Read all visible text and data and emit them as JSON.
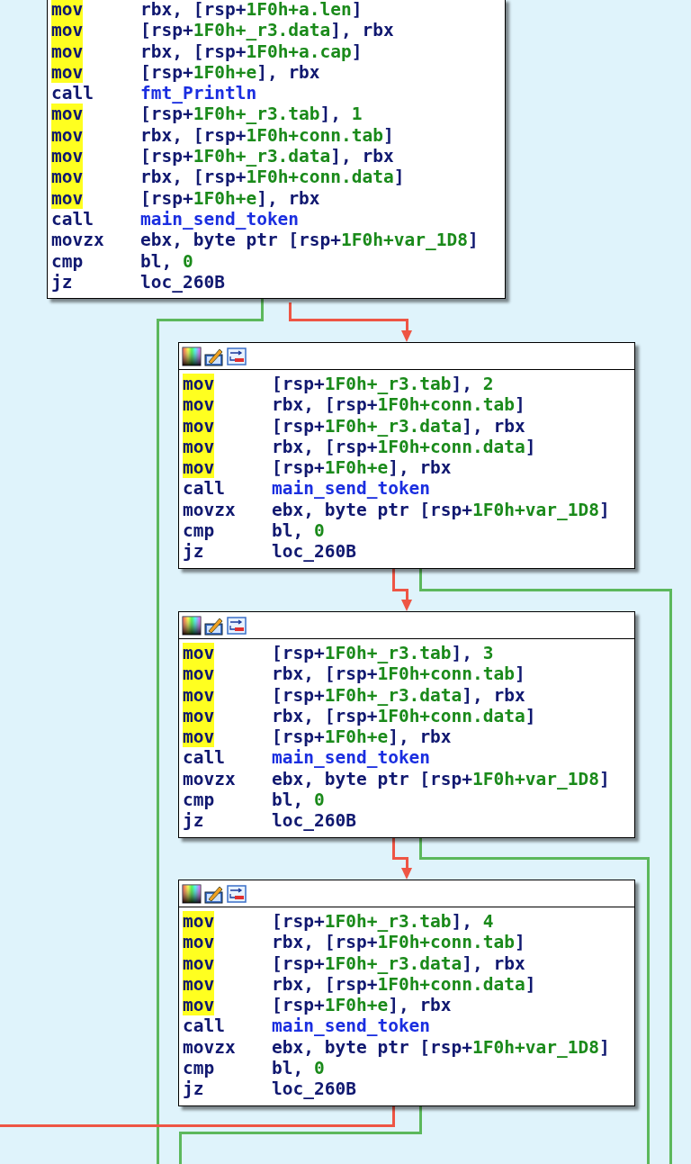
{
  "blocks": [
    {
      "toolbar": false,
      "lines": [
        {
          "mnemonic": "mov",
          "highlighted": true,
          "operand": [
            {
              "text": "rbx, [rsp+",
              "kind": "reg"
            },
            {
              "text": "1F0h+a.len",
              "kind": "num"
            },
            {
              "text": "]",
              "kind": "reg"
            }
          ]
        },
        {
          "mnemonic": "mov",
          "highlighted": true,
          "operand": [
            {
              "text": "[rsp+",
              "kind": "reg"
            },
            {
              "text": "1F0h+_r3.data",
              "kind": "num"
            },
            {
              "text": "], rbx",
              "kind": "reg"
            }
          ]
        },
        {
          "mnemonic": "mov",
          "highlighted": true,
          "operand": [
            {
              "text": "rbx, [rsp+",
              "kind": "reg"
            },
            {
              "text": "1F0h+a.cap",
              "kind": "num"
            },
            {
              "text": "]",
              "kind": "reg"
            }
          ]
        },
        {
          "mnemonic": "mov",
          "highlighted": true,
          "operand": [
            {
              "text": "[rsp+",
              "kind": "reg"
            },
            {
              "text": "1F0h+e",
              "kind": "num"
            },
            {
              "text": "], rbx",
              "kind": "reg"
            }
          ]
        },
        {
          "mnemonic": "call",
          "highlighted": false,
          "operand": [
            {
              "text": "fmt_Println",
              "kind": "name"
            }
          ]
        },
        {
          "mnemonic": "mov",
          "highlighted": true,
          "operand": [
            {
              "text": "[rsp+",
              "kind": "reg"
            },
            {
              "text": "1F0h+_r3.tab",
              "kind": "num"
            },
            {
              "text": "], ",
              "kind": "reg"
            },
            {
              "text": "1",
              "kind": "num"
            }
          ]
        },
        {
          "mnemonic": "mov",
          "highlighted": true,
          "operand": [
            {
              "text": "rbx, [rsp+",
              "kind": "reg"
            },
            {
              "text": "1F0h+conn.tab",
              "kind": "num"
            },
            {
              "text": "]",
              "kind": "reg"
            }
          ]
        },
        {
          "mnemonic": "mov",
          "highlighted": true,
          "operand": [
            {
              "text": "[rsp+",
              "kind": "reg"
            },
            {
              "text": "1F0h+_r3.data",
              "kind": "num"
            },
            {
              "text": "], rbx",
              "kind": "reg"
            }
          ]
        },
        {
          "mnemonic": "mov",
          "highlighted": true,
          "operand": [
            {
              "text": "rbx, [rsp+",
              "kind": "reg"
            },
            {
              "text": "1F0h+conn.data",
              "kind": "num"
            },
            {
              "text": "]",
              "kind": "reg"
            }
          ]
        },
        {
          "mnemonic": "mov",
          "highlighted": true,
          "operand": [
            {
              "text": "[rsp+",
              "kind": "reg"
            },
            {
              "text": "1F0h+e",
              "kind": "num"
            },
            {
              "text": "], rbx",
              "kind": "reg"
            }
          ]
        },
        {
          "mnemonic": "call",
          "highlighted": false,
          "operand": [
            {
              "text": "main_send_token",
              "kind": "name"
            }
          ]
        },
        {
          "mnemonic": "movzx",
          "highlighted": false,
          "operand": [
            {
              "text": "ebx, byte ptr [rsp+",
              "kind": "reg"
            },
            {
              "text": "1F0h+var_1D8",
              "kind": "num"
            },
            {
              "text": "]",
              "kind": "reg"
            }
          ]
        },
        {
          "mnemonic": "cmp",
          "highlighted": false,
          "operand": [
            {
              "text": "bl, ",
              "kind": "reg"
            },
            {
              "text": "0",
              "kind": "num"
            }
          ]
        },
        {
          "mnemonic": "jz",
          "highlighted": false,
          "operand": [
            {
              "text": "loc_260B",
              "kind": "reg"
            }
          ]
        }
      ]
    },
    {
      "toolbar": true,
      "lines": [
        {
          "mnemonic": "mov",
          "highlighted": true,
          "operand": [
            {
              "text": "[rsp+",
              "kind": "reg"
            },
            {
              "text": "1F0h+_r3.tab",
              "kind": "num"
            },
            {
              "text": "], ",
              "kind": "reg"
            },
            {
              "text": "2",
              "kind": "num"
            }
          ]
        },
        {
          "mnemonic": "mov",
          "highlighted": true,
          "operand": [
            {
              "text": "rbx, [rsp+",
              "kind": "reg"
            },
            {
              "text": "1F0h+conn.tab",
              "kind": "num"
            },
            {
              "text": "]",
              "kind": "reg"
            }
          ]
        },
        {
          "mnemonic": "mov",
          "highlighted": true,
          "operand": [
            {
              "text": "[rsp+",
              "kind": "reg"
            },
            {
              "text": "1F0h+_r3.data",
              "kind": "num"
            },
            {
              "text": "], rbx",
              "kind": "reg"
            }
          ]
        },
        {
          "mnemonic": "mov",
          "highlighted": true,
          "operand": [
            {
              "text": "rbx, [rsp+",
              "kind": "reg"
            },
            {
              "text": "1F0h+conn.data",
              "kind": "num"
            },
            {
              "text": "]",
              "kind": "reg"
            }
          ]
        },
        {
          "mnemonic": "mov",
          "highlighted": true,
          "operand": [
            {
              "text": "[rsp+",
              "kind": "reg"
            },
            {
              "text": "1F0h+e",
              "kind": "num"
            },
            {
              "text": "], rbx",
              "kind": "reg"
            }
          ]
        },
        {
          "mnemonic": "call",
          "highlighted": false,
          "operand": [
            {
              "text": "main_send_token",
              "kind": "name"
            }
          ]
        },
        {
          "mnemonic": "movzx",
          "highlighted": false,
          "operand": [
            {
              "text": "ebx, byte ptr [rsp+",
              "kind": "reg"
            },
            {
              "text": "1F0h+var_1D8",
              "kind": "num"
            },
            {
              "text": "]",
              "kind": "reg"
            }
          ]
        },
        {
          "mnemonic": "cmp",
          "highlighted": false,
          "operand": [
            {
              "text": "bl, ",
              "kind": "reg"
            },
            {
              "text": "0",
              "kind": "num"
            }
          ]
        },
        {
          "mnemonic": "jz",
          "highlighted": false,
          "operand": [
            {
              "text": "loc_260B",
              "kind": "reg"
            }
          ]
        }
      ]
    },
    {
      "toolbar": true,
      "lines": [
        {
          "mnemonic": "mov",
          "highlighted": true,
          "operand": [
            {
              "text": "[rsp+",
              "kind": "reg"
            },
            {
              "text": "1F0h+_r3.tab",
              "kind": "num"
            },
            {
              "text": "], ",
              "kind": "reg"
            },
            {
              "text": "3",
              "kind": "num"
            }
          ]
        },
        {
          "mnemonic": "mov",
          "highlighted": true,
          "operand": [
            {
              "text": "rbx, [rsp+",
              "kind": "reg"
            },
            {
              "text": "1F0h+conn.tab",
              "kind": "num"
            },
            {
              "text": "]",
              "kind": "reg"
            }
          ]
        },
        {
          "mnemonic": "mov",
          "highlighted": true,
          "operand": [
            {
              "text": "[rsp+",
              "kind": "reg"
            },
            {
              "text": "1F0h+_r3.data",
              "kind": "num"
            },
            {
              "text": "], rbx",
              "kind": "reg"
            }
          ]
        },
        {
          "mnemonic": "mov",
          "highlighted": true,
          "operand": [
            {
              "text": "rbx, [rsp+",
              "kind": "reg"
            },
            {
              "text": "1F0h+conn.data",
              "kind": "num"
            },
            {
              "text": "]",
              "kind": "reg"
            }
          ]
        },
        {
          "mnemonic": "mov",
          "highlighted": true,
          "operand": [
            {
              "text": "[rsp+",
              "kind": "reg"
            },
            {
              "text": "1F0h+e",
              "kind": "num"
            },
            {
              "text": "], rbx",
              "kind": "reg"
            }
          ]
        },
        {
          "mnemonic": "call",
          "highlighted": false,
          "operand": [
            {
              "text": "main_send_token",
              "kind": "name"
            }
          ]
        },
        {
          "mnemonic": "movzx",
          "highlighted": false,
          "operand": [
            {
              "text": "ebx, byte ptr [rsp+",
              "kind": "reg"
            },
            {
              "text": "1F0h+var_1D8",
              "kind": "num"
            },
            {
              "text": "]",
              "kind": "reg"
            }
          ]
        },
        {
          "mnemonic": "cmp",
          "highlighted": false,
          "operand": [
            {
              "text": "bl, ",
              "kind": "reg"
            },
            {
              "text": "0",
              "kind": "num"
            }
          ]
        },
        {
          "mnemonic": "jz",
          "highlighted": false,
          "operand": [
            {
              "text": "loc_260B",
              "kind": "reg"
            }
          ]
        }
      ]
    },
    {
      "toolbar": true,
      "lines": [
        {
          "mnemonic": "mov",
          "highlighted": true,
          "operand": [
            {
              "text": "[rsp+",
              "kind": "reg"
            },
            {
              "text": "1F0h+_r3.tab",
              "kind": "num"
            },
            {
              "text": "], ",
              "kind": "reg"
            },
            {
              "text": "4",
              "kind": "num"
            }
          ]
        },
        {
          "mnemonic": "mov",
          "highlighted": true,
          "operand": [
            {
              "text": "rbx, [rsp+",
              "kind": "reg"
            },
            {
              "text": "1F0h+conn.tab",
              "kind": "num"
            },
            {
              "text": "]",
              "kind": "reg"
            }
          ]
        },
        {
          "mnemonic": "mov",
          "highlighted": true,
          "operand": [
            {
              "text": "[rsp+",
              "kind": "reg"
            },
            {
              "text": "1F0h+_r3.data",
              "kind": "num"
            },
            {
              "text": "], rbx",
              "kind": "reg"
            }
          ]
        },
        {
          "mnemonic": "mov",
          "highlighted": true,
          "operand": [
            {
              "text": "rbx, [rsp+",
              "kind": "reg"
            },
            {
              "text": "1F0h+conn.data",
              "kind": "num"
            },
            {
              "text": "]",
              "kind": "reg"
            }
          ]
        },
        {
          "mnemonic": "mov",
          "highlighted": true,
          "operand": [
            {
              "text": "[rsp+",
              "kind": "reg"
            },
            {
              "text": "1F0h+e",
              "kind": "num"
            },
            {
              "text": "], rbx",
              "kind": "reg"
            }
          ]
        },
        {
          "mnemonic": "call",
          "highlighted": false,
          "operand": [
            {
              "text": "main_send_token",
              "kind": "name"
            }
          ]
        },
        {
          "mnemonic": "movzx",
          "highlighted": false,
          "operand": [
            {
              "text": "ebx, byte ptr [rsp+",
              "kind": "reg"
            },
            {
              "text": "1F0h+var_1D8",
              "kind": "num"
            },
            {
              "text": "]",
              "kind": "reg"
            }
          ]
        },
        {
          "mnemonic": "cmp",
          "highlighted": false,
          "operand": [
            {
              "text": "bl, ",
              "kind": "reg"
            },
            {
              "text": "0",
              "kind": "num"
            }
          ]
        },
        {
          "mnemonic": "jz",
          "highlighted": false,
          "operand": [
            {
              "text": "loc_260B",
              "kind": "reg"
            }
          ]
        }
      ]
    }
  ],
  "edges": [
    {
      "color": "#ee5544",
      "arrow": true
    },
    {
      "color": "#5cb85c",
      "arrow": false
    },
    {
      "color": "#ee5544",
      "arrow": true
    },
    {
      "color": "#5cb85c",
      "arrow": false
    },
    {
      "color": "#ee5544",
      "arrow": true
    },
    {
      "color": "#5cb85c",
      "arrow": false
    },
    {
      "color": "#ee5544",
      "arrow": false
    },
    {
      "color": "#5cb85c",
      "arrow": false
    }
  ]
}
